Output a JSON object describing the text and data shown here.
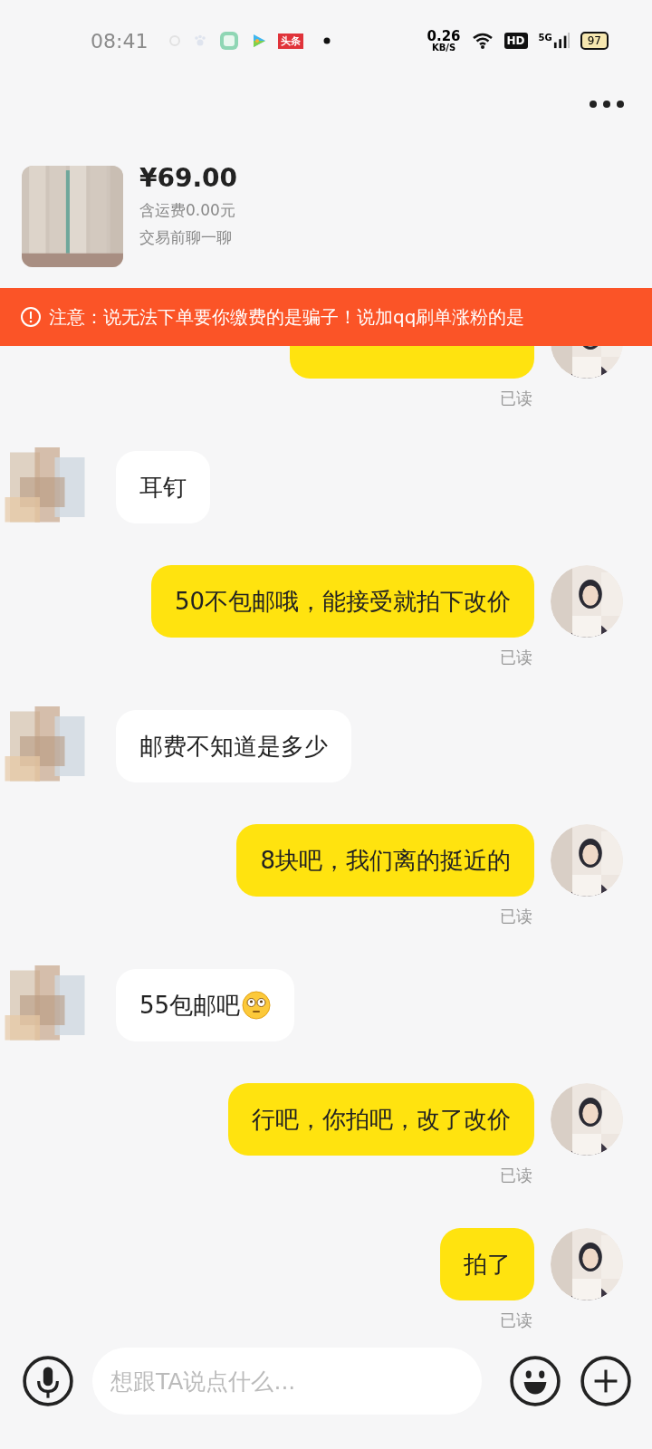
{
  "status_bar": {
    "time": "08:41",
    "news_badge": "头条",
    "net_speed": "0.26",
    "net_unit": "KB/S",
    "hd_badge": "HD",
    "signal_label": "5G",
    "battery": "97"
  },
  "product": {
    "price": "¥69.00",
    "shipping": "含运费0.00元",
    "subtitle": "交易前聊一聊"
  },
  "notice": {
    "text": "注意：说无法下单要你缴费的是骗子！说加qq刷单涨粉的是"
  },
  "messages": [
    {
      "kind": "outgoing",
      "read": "已读"
    },
    {
      "kind": "incoming",
      "text": "耳钉"
    },
    {
      "kind": "outgoing",
      "text": "50不包邮哦，能接受就拍下改价",
      "read": "已读"
    },
    {
      "kind": "incoming",
      "text": "邮费不知道是多少"
    },
    {
      "kind": "outgoing",
      "text": "8块吧，我们离的挺近的",
      "read": "已读"
    },
    {
      "kind": "incoming",
      "text": "55包邮吧",
      "emoji": true
    },
    {
      "kind": "outgoing",
      "text": "行吧，你拍吧，改了改价",
      "read": "已读"
    },
    {
      "kind": "outgoing",
      "text": "拍了",
      "read": "已读"
    }
  ],
  "input": {
    "placeholder": "想跟TA说点什么..."
  }
}
